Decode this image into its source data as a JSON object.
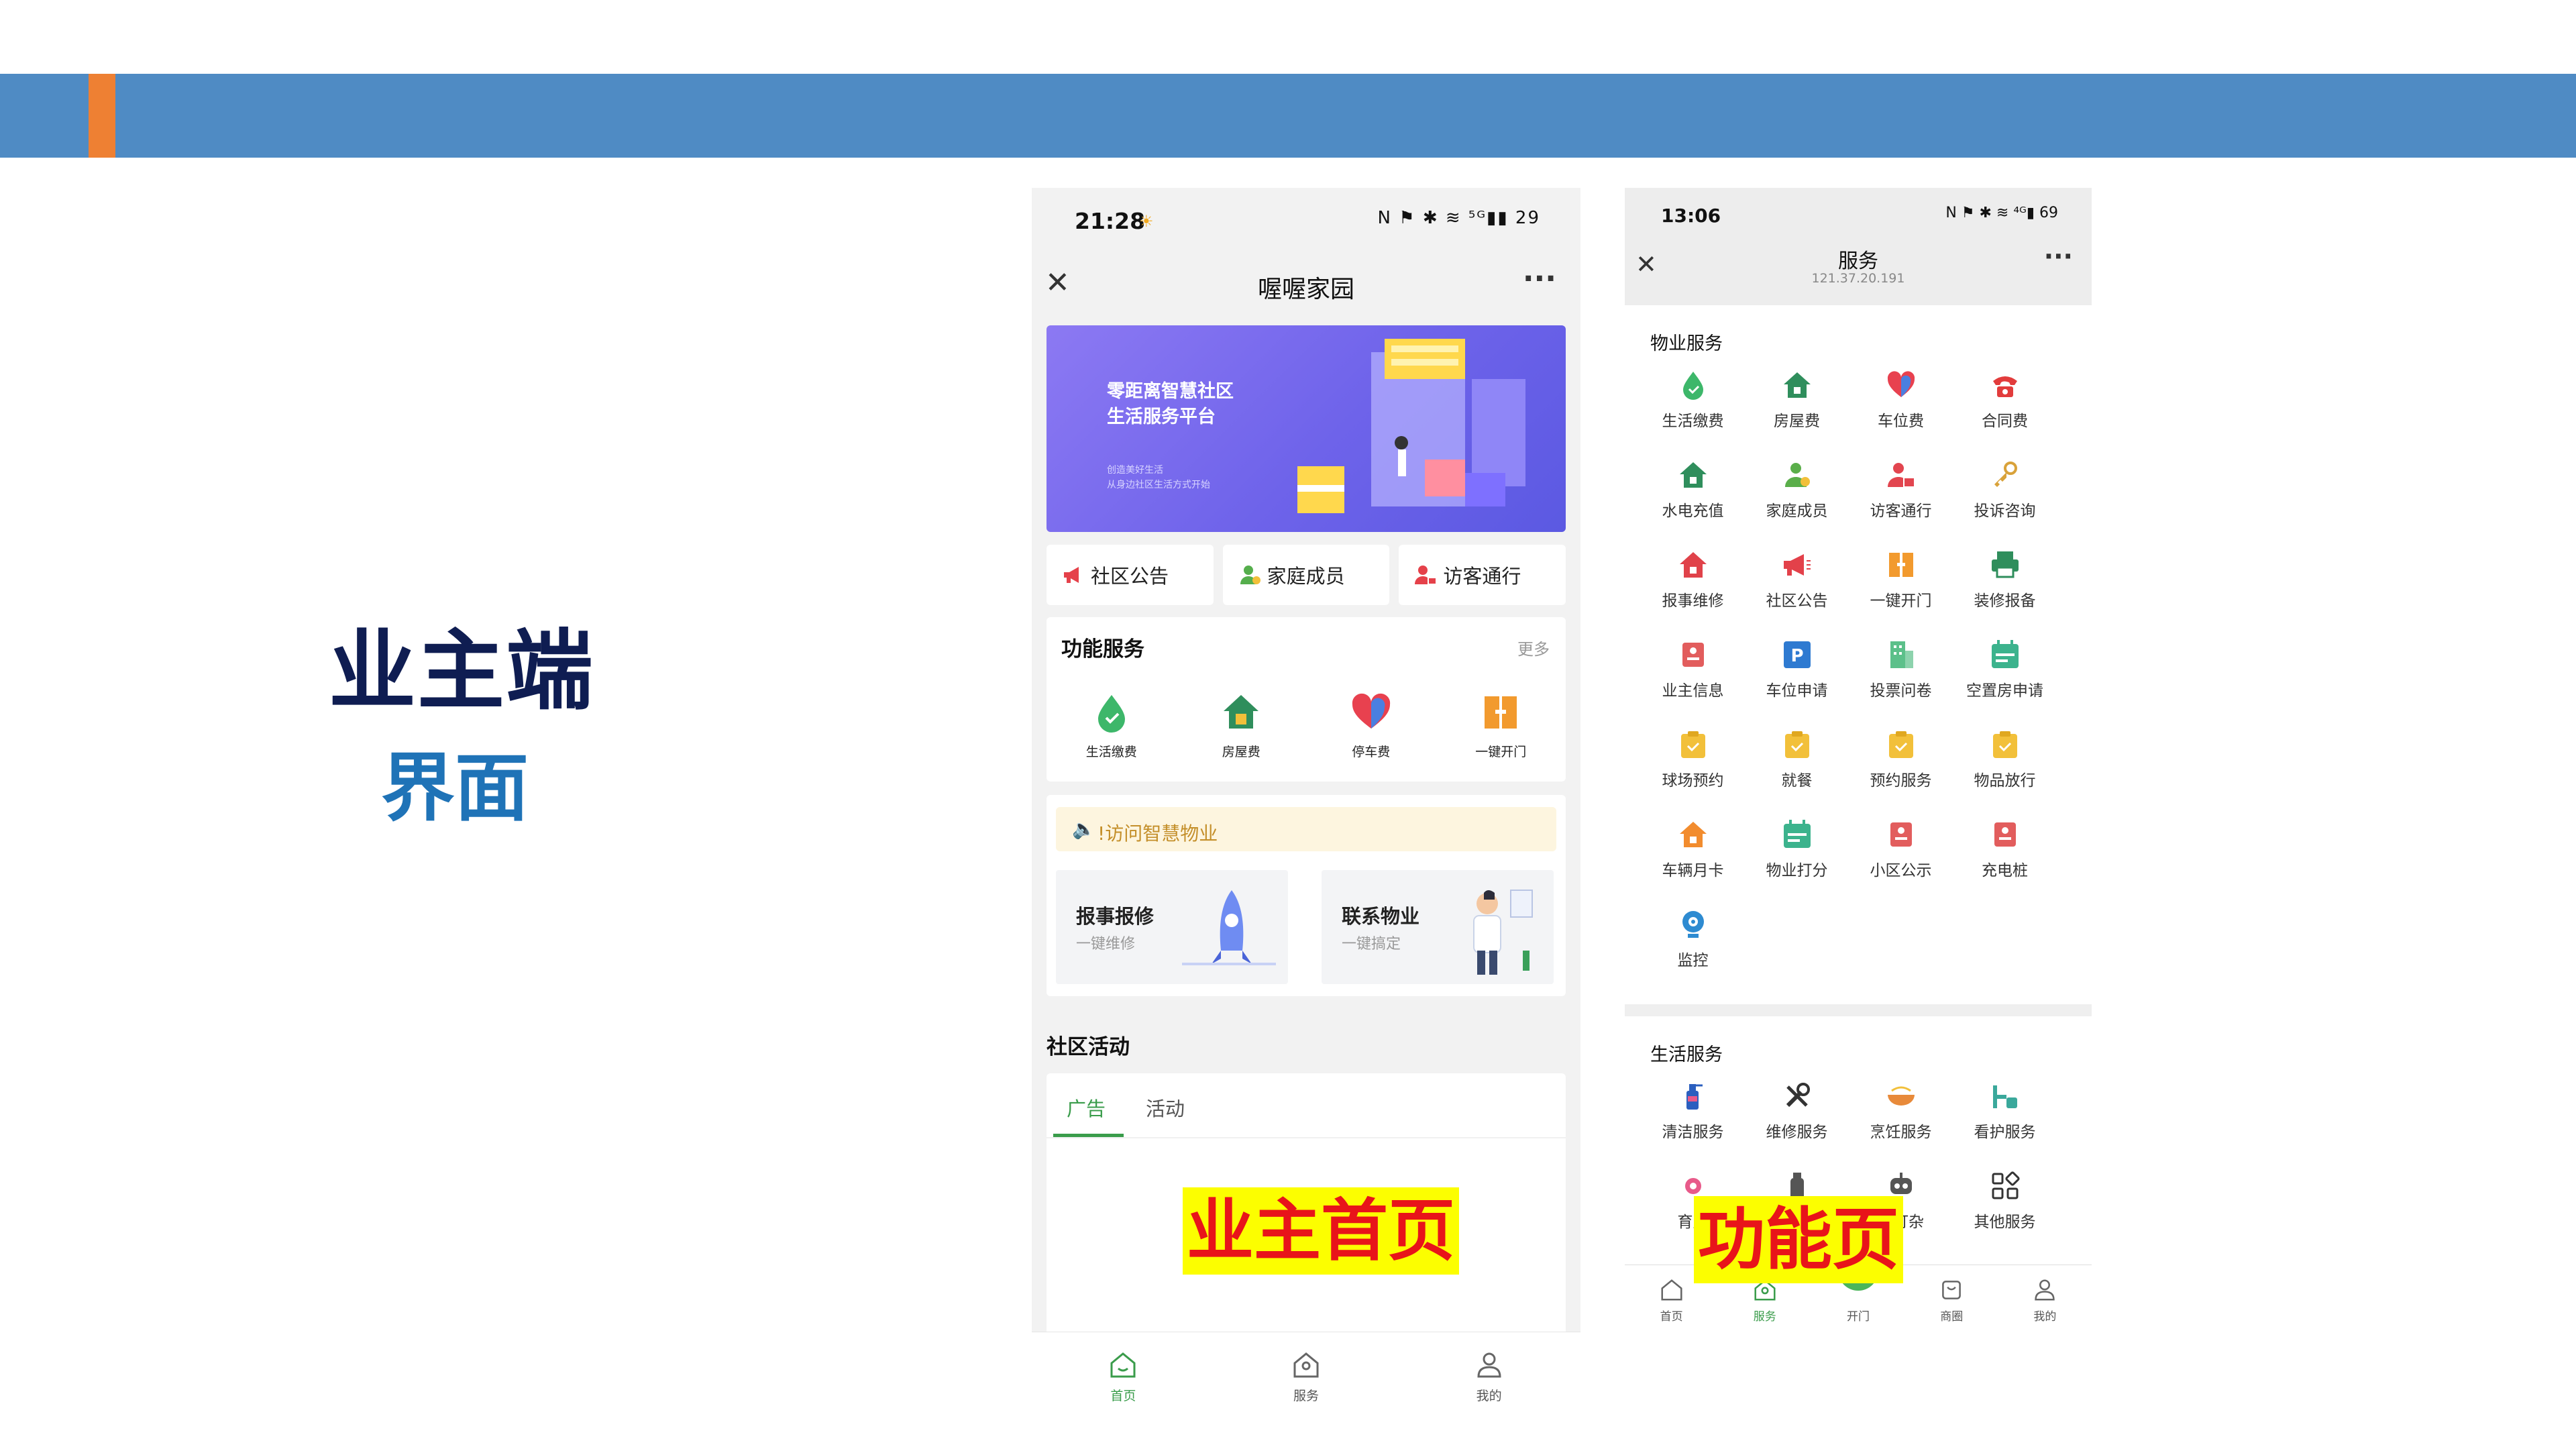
{
  "slide": {
    "title": "业主端",
    "subtitle": "界面",
    "colors": {
      "band": "#4f8bc4",
      "accent": "#ee8033",
      "title": "#0f1d52",
      "subtitle": "#1f73b7"
    }
  },
  "stamps": {
    "home": "业主首页",
    "function": "功能页"
  },
  "phone1": {
    "status": {
      "time": "21:28",
      "icons": "N ⚑ ✱ ≋ ⁵ᴳ▮▮ 29",
      "sun_icon": "☀"
    },
    "nav": {
      "close": "✕",
      "title": "喔喔家园",
      "more": "···"
    },
    "banner": {
      "title_line1": "零距离智慧社区",
      "title_line2": "生活服务平台",
      "small_line1": "创造美好生活",
      "small_line2": "从身边社区生活方式开始"
    },
    "quick": [
      {
        "label": "社区公告",
        "icon": "megaphone-icon"
      },
      {
        "label": "家庭成员",
        "icon": "member-icon"
      },
      {
        "label": "访客通行",
        "icon": "visitor-icon"
      }
    ],
    "func": {
      "title": "功能服务",
      "more": "更多",
      "items": [
        {
          "label": "生活缴费",
          "icon": "drop-icon"
        },
        {
          "label": "房屋费",
          "icon": "house-icon"
        },
        {
          "label": "停车费",
          "icon": "heart-icon"
        },
        {
          "label": "一键开门",
          "icon": "door-icon"
        }
      ]
    },
    "smart": {
      "notice_icon": "🔈",
      "notice": "!访问智慧物业",
      "repair_title": "报事报修",
      "repair_sub": "一键维修",
      "contact_title": "联系物业",
      "contact_sub": "一键搞定"
    },
    "activity": {
      "title": "社区活动",
      "tabs": [
        "广告",
        "活动"
      ]
    },
    "tabbar": [
      {
        "label": "首页",
        "icon": "home-icon",
        "active": true
      },
      {
        "label": "服务",
        "icon": "service-icon",
        "active": false
      },
      {
        "label": "我的",
        "icon": "user-icon",
        "active": false
      }
    ]
  },
  "phone2": {
    "status": {
      "time": "13:06",
      "icons": "N ⚑ ✱ ≋ ⁴ᴳ▮ 69"
    },
    "nav": {
      "close": "✕",
      "title": "服务",
      "subtitle": "121.37.20.191",
      "more": "···"
    },
    "property": {
      "title": "物业服务",
      "items": [
        {
          "label": "生活缴费",
          "icon": "drop-icon",
          "color": "#3db76a"
        },
        {
          "label": "房屋费",
          "icon": "house-icon",
          "color": "#2f8e5c"
        },
        {
          "label": "车位费",
          "icon": "heart-icon",
          "color": "#e8414f"
        },
        {
          "label": "合同费",
          "icon": "phone-icon",
          "color": "#e23c3c"
        },
        {
          "label": "水电充值",
          "icon": "house-icon",
          "color": "#2f8e5c"
        },
        {
          "label": "家庭成员",
          "icon": "member-icon",
          "color": "#5aae4a"
        },
        {
          "label": "访客通行",
          "icon": "visitor-icon",
          "color": "#e2454f"
        },
        {
          "label": "投诉咨询",
          "icon": "key-icon",
          "color": "#d9a23a"
        },
        {
          "label": "报事维修",
          "icon": "house-icon",
          "color": "#e0424a"
        },
        {
          "label": "社区公告",
          "icon": "megaphone-icon",
          "color": "#e3414a"
        },
        {
          "label": "一键开门",
          "icon": "door-icon",
          "color": "#f29a2e"
        },
        {
          "label": "装修报备",
          "icon": "printer-icon",
          "color": "#2f8e5c"
        },
        {
          "label": "业主信息",
          "icon": "id-card-icon",
          "color": "#e25d5d"
        },
        {
          "label": "车位申请",
          "icon": "parking-icon",
          "color": "#2e7ad1"
        },
        {
          "label": "投票问卷",
          "icon": "building-icon",
          "color": "#5cc08a"
        },
        {
          "label": "空置房申请",
          "icon": "calendar-icon",
          "color": "#3cb38d"
        },
        {
          "label": "球场预约",
          "icon": "clipboard-icon",
          "color": "#f2c03a"
        },
        {
          "label": "就餐",
          "icon": "clipboard-icon",
          "color": "#f2c03a"
        },
        {
          "label": "预约服务",
          "icon": "clipboard-icon",
          "color": "#f2c03a"
        },
        {
          "label": "物品放行",
          "icon": "clipboard-icon",
          "color": "#f2c03a"
        },
        {
          "label": "车辆月卡",
          "icon": "house-icon",
          "color": "#f28c2e"
        },
        {
          "label": "物业打分",
          "icon": "calendar-icon",
          "color": "#3cb38d"
        },
        {
          "label": "小区公示",
          "icon": "id-card-icon",
          "color": "#e25d5d"
        },
        {
          "label": "充电桩",
          "icon": "id-card-icon",
          "color": "#e25d5d"
        },
        {
          "label": "监控",
          "icon": "camera-icon",
          "color": "#2e8bd1"
        }
      ]
    },
    "life": {
      "title": "生活服务",
      "items": [
        {
          "label": "清洁服务",
          "icon": "spray-icon",
          "color": "#2b5fbf"
        },
        {
          "label": "维修服务",
          "icon": "tools-icon",
          "color": "#333333"
        },
        {
          "label": "烹饪服务",
          "icon": "bowl-icon",
          "color": "#e88a3a"
        },
        {
          "label": "看护服务",
          "icon": "care-icon",
          "color": "#3aa89b"
        },
        {
          "label": "育儿",
          "icon": "baby-icon",
          "color": "#e85a8a"
        },
        {
          "label": "",
          "icon": "bottle-icon",
          "color": "#555555"
        },
        {
          "label": "勤打杂",
          "icon": "robot-icon",
          "color": "#555555"
        },
        {
          "label": "其他服务",
          "icon": "grid-icon",
          "color": "#333333"
        }
      ]
    },
    "tabbar": [
      {
        "label": "首页",
        "icon": "home-icon",
        "active": false
      },
      {
        "label": "服务",
        "icon": "service-icon",
        "active": true
      },
      {
        "label": "开门",
        "icon": "open-icon",
        "active": false
      },
      {
        "label": "商圈",
        "icon": "shop-icon",
        "active": false
      },
      {
        "label": "我的",
        "icon": "user-icon",
        "active": false
      }
    ]
  }
}
